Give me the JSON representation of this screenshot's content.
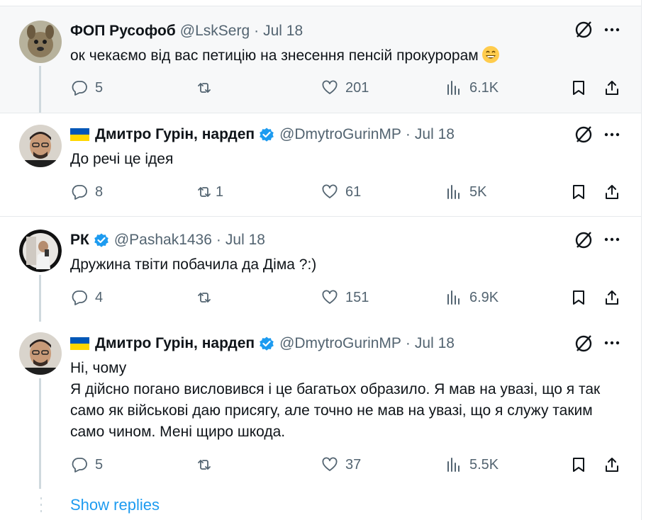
{
  "tweets": [
    {
      "name": "ФОП Русофоб",
      "handle": "@LskSerg",
      "date": "Jul 18",
      "text": [
        "ок чекаємо від вас петицію на знесення пенсій прокурорам"
      ],
      "emoji": "grinning-face-emoji",
      "flag": false,
      "verified": false,
      "replies": "5",
      "reposts": "",
      "likes": "201",
      "views": "6.1K"
    },
    {
      "name": "Дмитро Гурін, нардеп",
      "handle": "@DmytroGurinMP",
      "date": "Jul 18",
      "text": [
        "До речі це ідея"
      ],
      "flag": true,
      "verified": true,
      "replies": "8",
      "reposts": "1",
      "likes": "61",
      "views": "5K"
    },
    {
      "name": "РК",
      "handle": "@Pashak1436",
      "date": "Jul 18",
      "text": [
        "Дружина твіти побачила да Діма ?:)"
      ],
      "flag": false,
      "verified": true,
      "replies": "4",
      "reposts": "",
      "likes": "151",
      "views": "6.9K"
    },
    {
      "name": "Дмитро Гурін, нардеп",
      "handle": "@DmytroGurinMP",
      "date": "Jul 18",
      "text": [
        "Ні, чому",
        "Я дійсно погано висловився і це багатьох образило. Я мав на увазі, що я так само як військові даю присягу, але точно не мав на увазі, що я служу таким само чином. Мені щиро шкода."
      ],
      "flag": true,
      "verified": true,
      "replies": "5",
      "reposts": "",
      "likes": "37",
      "views": "5.5K"
    }
  ],
  "show_replies_label": "Show replies",
  "colors": {
    "accent": "#1d9bf0",
    "muted": "#536471",
    "text": "#0f1419",
    "highlight_bg": "#f7f8f9",
    "border": "#e6e9ec",
    "thread_line": "#cfd9de",
    "flag_blue": "#0057b7",
    "flag_yellow": "#ffd700"
  },
  "icons": {
    "reply": "reply-bubble-icon",
    "repost": "repost-arrows-icon",
    "like": "heart-icon",
    "views": "views-bar-chart-icon",
    "bookmark": "bookmark-icon",
    "share": "share-upload-icon",
    "grok": "grok-slash-circle-icon",
    "more": "more-dots-icon",
    "verified": "verified-badge-icon"
  }
}
